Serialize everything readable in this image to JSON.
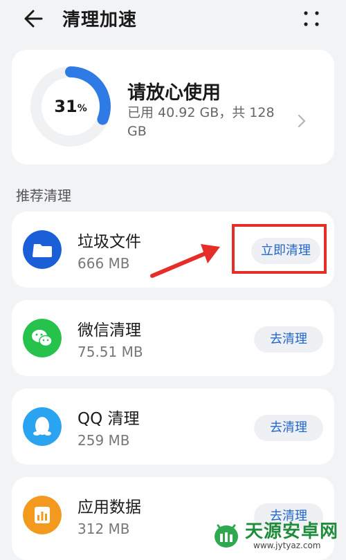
{
  "header": {
    "title": "清理加速"
  },
  "storage": {
    "percent": "31",
    "percent_sign": "%",
    "usage_fraction": 0.31,
    "title": "请放心使用",
    "detail": "已用 40.92 GB，共 128 GB"
  },
  "section": {
    "label": "推荐清理"
  },
  "items": [
    {
      "name": "垃圾文件",
      "size": "666 MB",
      "button": "立即清理",
      "icon": "folder-icon"
    },
    {
      "name": "微信清理",
      "size": "75.51 MB",
      "button": "去清理",
      "icon": "wechat-icon"
    },
    {
      "name": "QQ 清理",
      "size": "259 MB",
      "button": "去清理",
      "icon": "qq-icon"
    },
    {
      "name": "应用数据",
      "size": "312 MB",
      "button": "去清理",
      "icon": "app-data-icon"
    }
  ],
  "watermark": {
    "text": "天源安卓网",
    "url": "www.jytyaz.com"
  },
  "colors": {
    "accent": "#2366cc",
    "ring_fill": "#2f7be6",
    "folder_icon": "#1a5fd8",
    "wechat_icon": "#27c24c",
    "qq_icon": "#2aa3f0",
    "app_data_icon": "#f39a1e",
    "annotation": "#e52d2a"
  }
}
